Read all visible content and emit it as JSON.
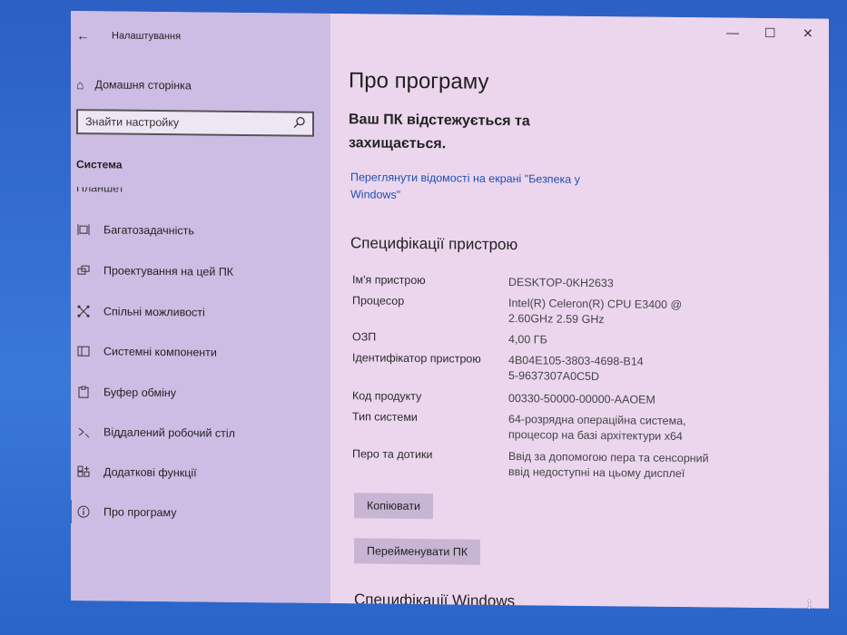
{
  "app": {
    "title": "Налаштування"
  },
  "sidebar": {
    "home_label": "Домашня сторінка",
    "search_placeholder": "Знайти настройку",
    "section_label": "Система",
    "cut_item": "Планшет",
    "items": [
      {
        "label": "Багатозадачність",
        "icon": "multitasking-icon"
      },
      {
        "label": "Проектування на цей ПК",
        "icon": "projecting-icon"
      },
      {
        "label": "Спільні можливості",
        "icon": "shared-experiences-icon"
      },
      {
        "label": "Системні компоненти",
        "icon": "system-components-icon"
      },
      {
        "label": "Буфер обміну",
        "icon": "clipboard-icon"
      },
      {
        "label": "Віддалений робочий стіл",
        "icon": "remote-desktop-icon"
      },
      {
        "label": "Додаткові функції",
        "icon": "optional-features-icon"
      },
      {
        "label": "Про програму",
        "icon": "info-icon",
        "active": true
      }
    ]
  },
  "main": {
    "title": "Про програму",
    "protection_text": "Ваш ПК відстежується та захищається.",
    "security_link": "Переглянути відомості на екрані \"Безпека у Windows\"",
    "device_specs_title": "Специфікації пристрою",
    "specs": [
      {
        "key": "Ім'я пристрою",
        "value": "DESKTOP-0KH2633"
      },
      {
        "key": "Процесор",
        "value": "Intel(R) Celeron(R) CPU E3400 @ 2.60GHz 2.59 GHz"
      },
      {
        "key": "ОЗП",
        "value": "4,00 ГБ"
      },
      {
        "key": "Ідентифікатор пристрою",
        "value": "4B04E105-3803-4698-B145-9637307A0C5D"
      },
      {
        "key": "Код продукту",
        "value": "00330-50000-00000-AAOEM"
      },
      {
        "key": "Тип системи",
        "value": "64-розрядна операційна система, процесор на базі архітектури x64"
      },
      {
        "key": "Перо та дотики",
        "value": "Ввід за допомогою пера та сенсорний ввід недоступні на цьому дисплеї"
      }
    ],
    "copy_button": "Копіювати",
    "rename_button": "Перейменувати ПК",
    "windows_specs_title": "Специфікації Windows"
  },
  "window_controls": {
    "minimize": "—",
    "maximize": "☐",
    "close": "✕"
  },
  "colors": {
    "sidebar_bg": "#cdbde4",
    "content_bg": "#ecd6ee",
    "link": "#2050b0",
    "accent": "#3a6fd8"
  }
}
